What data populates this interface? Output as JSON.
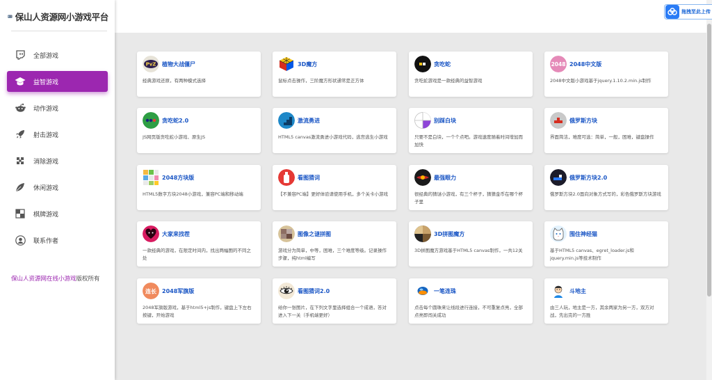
{
  "brand": {
    "title": "保山人资源网小游戏平台",
    "logo_icon": "gamepad-icon"
  },
  "sidebar": {
    "items": [
      {
        "label": "全部游戏",
        "icon": "twitch-icon"
      },
      {
        "label": "益智游戏",
        "icon": "graduation-cap-icon",
        "active": true
      },
      {
        "label": "动作游戏",
        "icon": "reddit-icon"
      },
      {
        "label": "射击游戏",
        "icon": "rocket-icon"
      },
      {
        "label": "消除游戏",
        "icon": "puzzle-icon"
      },
      {
        "label": "休闲游戏",
        "icon": "leaf-icon"
      },
      {
        "label": "棋牌游戏",
        "icon": "chess-icon"
      },
      {
        "label": "联系作者",
        "icon": "user-icon"
      }
    ],
    "footer_link": "保山人资源网在线小游戏",
    "footer_suffix": "版权所有"
  },
  "widget": {
    "label": "拖拽至此上传",
    "icon": "cloud-upload-icon"
  },
  "accent_color": "#9c27b0",
  "title_color": "#1a56c5",
  "games": [
    {
      "title": "植物大战僵尸",
      "desc": "经典游戏还原，有两种模式选择",
      "icon": "pvz-icon"
    },
    {
      "title": "3D魔方",
      "desc": "鼠标点击操作，三阶魔方形状通常是正方体",
      "icon": "rubiks-cube-icon"
    },
    {
      "title": "贪吃蛇",
      "desc": "贪吃蛇游戏是一款经典的益智游戏",
      "icon": "snake-icon"
    },
    {
      "title": "2048中文版",
      "desc": "2048中文版小游戏基于jquery.1.10.2.min.js制作",
      "icon": "2048-icon",
      "icon_text": "2048"
    },
    {
      "title": "贪吃蛇2.0",
      "desc": "JS网页版贪吃蛇小游戏、原生JS",
      "icon": "snake2-icon"
    },
    {
      "title": "激流勇进",
      "desc": "HTML5 canvas激流勇进小游戏代码，逃宫逃生小游戏",
      "icon": "stairs-icon"
    },
    {
      "title": "别踩白块",
      "desc": "只要不是白块，一个个点吧。游戏速度随着时间增加而加快",
      "icon": "tiles-icon"
    },
    {
      "title": "俄罗斯方块",
      "desc": "界面简洁，难度可选：简单，一般，困难，键盘操作",
      "icon": "tetris-icon"
    },
    {
      "title": "2048方块版",
      "desc": "HTML5数字方块2048小游戏，兼容PC端和移动端",
      "icon": "2048-grid-icon"
    },
    {
      "title": "看图猜词",
      "desc": "【不兼容PC端】更好体验请使用手机，多个关卡小游戏",
      "icon": "bottle-icon"
    },
    {
      "title": "最强眼力",
      "desc": "很经典的猜谜小游戏，有三个杯子，猜猜金币在哪个杯子里",
      "icon": "eye-icon"
    },
    {
      "title": "俄罗斯方块2.0",
      "desc": "俄罗斯方块2.0面向对象方式写的，彩色俄罗斯方块游戏",
      "icon": "tetris2-icon"
    },
    {
      "title": "大家来找茬",
      "desc": "一款经典的游戏，在限定时间内，找出两幅图的不同之处",
      "icon": "heart-icon"
    },
    {
      "title": "图像之谜拼图",
      "desc": "游戏分为简单，中等，困难，三个难度等级。记录操作步骤，纯html编写",
      "icon": "jigsaw-icon"
    },
    {
      "title": "3D拼图魔方",
      "desc": "3D拼图魔方游戏基于HTML5 canvas制作，一共12关",
      "icon": "cube-puzzle-icon"
    },
    {
      "title": "围住神经猫",
      "desc": "基于HTML5 canvas、egret_loader.js和jquery.min.js等技术制作",
      "icon": "cat-icon"
    },
    {
      "title": "2048军旗版",
      "desc": "2048军旗版游戏，基于html5+js制作，键盘上下左右按键，开始游戏",
      "icon": "army-icon",
      "icon_text": "连长"
    },
    {
      "title": "看图猜词2.0",
      "desc": "给你一张图片，在下列文字里选择组合一个成语，答对进入下一关（手机端更好）",
      "icon": "eye-drawing-icon"
    },
    {
      "title": "一笔连珠",
      "desc": "点击每个圆珠来让线段进行连接，不可重复点亮，全部点亮即闯关成功",
      "icon": "orb-icon"
    },
    {
      "title": "斗地主",
      "desc": "由三人玩，地主是一方，其余两家为另一方，双方对战，先出完的一方胜",
      "icon": "landlord-icon"
    }
  ]
}
